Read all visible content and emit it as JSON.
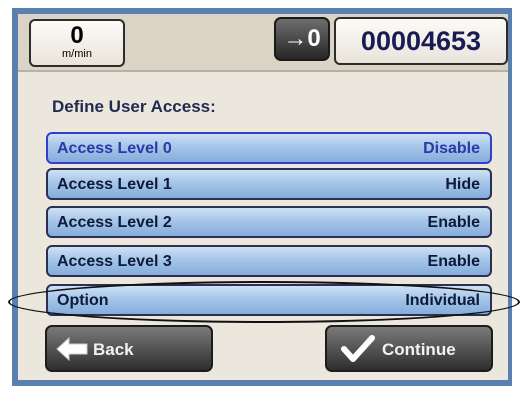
{
  "header": {
    "speed_value": "0",
    "speed_unit": "m/min",
    "reset_label": "→0",
    "counter": "00004653"
  },
  "main": {
    "heading": "Define User Access:",
    "rows": [
      {
        "label": "Access Level 0",
        "value": "Disable"
      },
      {
        "label": "Access Level 1",
        "value": "Hide"
      },
      {
        "label": "Access Level 2",
        "value": "Enable"
      },
      {
        "label": "Access Level 3",
        "value": "Enable"
      },
      {
        "label": "Option",
        "value": "Individual"
      }
    ]
  },
  "footer": {
    "back_label": "Back",
    "continue_label": "Continue"
  },
  "icons": {
    "back": "arrow-left-icon",
    "continue": "checkmark-icon"
  },
  "colors": {
    "frame": "#5a80b0",
    "row_fill": "#a9c8ea",
    "selected_border": "#3040c8"
  }
}
